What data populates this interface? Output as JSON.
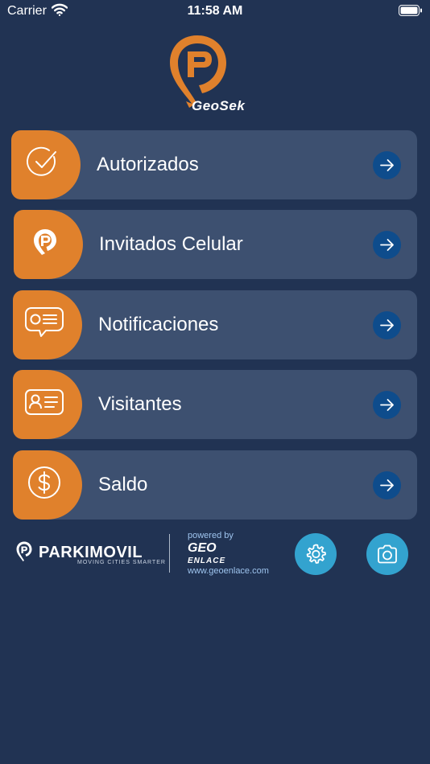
{
  "status_bar": {
    "carrier": "Carrier",
    "time": "11:58 AM"
  },
  "app": {
    "brand": "GeoSek"
  },
  "menu": [
    {
      "label": "Autorizados",
      "icon": "check-circle-icon"
    },
    {
      "label": "Invitados Celular",
      "icon": "location-pin-icon"
    },
    {
      "label": "Notificaciones",
      "icon": "message-bubble-icon"
    },
    {
      "label": "Visitantes",
      "icon": "id-card-icon"
    },
    {
      "label": "Saldo",
      "icon": "dollar-circle-icon"
    }
  ],
  "footer": {
    "parkimovil_name": "PARKIMOVIL",
    "parkimovil_tagline": "MOVING CITIES SMARTER",
    "powered_by": "powered by",
    "geoenlace_top": "GEO",
    "geoenlace_bottom": "ENLACE",
    "geoenlace_url": "www.geoenlace.com"
  },
  "colors": {
    "background": "#213353",
    "card": "#3d5070",
    "accent_orange": "#e0812c",
    "arrow_button": "#0e4c8c",
    "footer_button": "#33a3cf"
  }
}
